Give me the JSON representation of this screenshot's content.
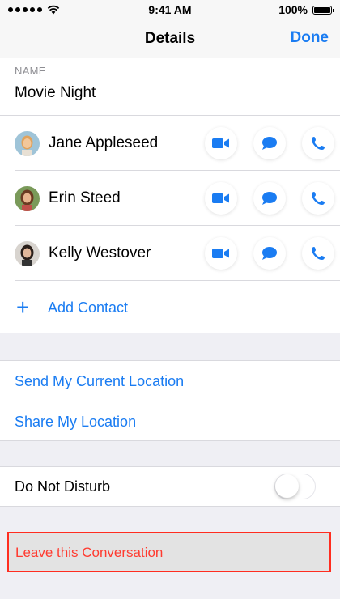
{
  "status_bar": {
    "time": "9:41 AM",
    "battery": "100%"
  },
  "nav": {
    "title": "Details",
    "done_label": "Done"
  },
  "group": {
    "name_label": "NAME",
    "name_value": "Movie Night"
  },
  "contacts": [
    {
      "name": "Jane Appleseed"
    },
    {
      "name": "Erin Steed"
    },
    {
      "name": "Kelly Westover"
    }
  ],
  "add_contact": {
    "icon": "plus-icon",
    "label": "Add Contact"
  },
  "location": {
    "send_current": "Send My Current Location",
    "share": "Share My Location"
  },
  "do_not_disturb": {
    "label": "Do Not Disturb",
    "enabled": false
  },
  "leave": {
    "label": "Leave this Conversation"
  },
  "colors": {
    "accent": "#1a7cf2",
    "destructive": "#ff3b30",
    "highlight_border": "#ff2d20"
  }
}
